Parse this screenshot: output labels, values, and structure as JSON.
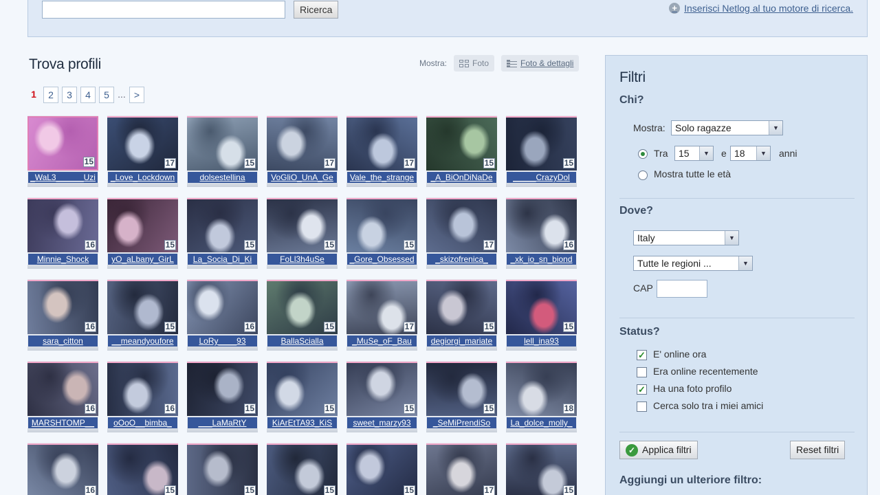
{
  "topbar": {
    "search_value": "",
    "search_button": "Ricerca",
    "add_engine_link": "Inserisci Netlog al tuo motore di ricerca."
  },
  "results": {
    "title": "Trova profili",
    "view_label": "Mostra:",
    "view_photo": "Foto",
    "view_details": "Foto & dettagli"
  },
  "pagination": {
    "current": "1",
    "pages": [
      "2",
      "3",
      "4",
      "5"
    ],
    "dots": "...",
    "next": ">"
  },
  "profiles": [
    {
      "name": "_WaL3______Uzi",
      "age": "15",
      "colors": [
        "#d88ad0",
        "#f1c9e6",
        "#b45fb0"
      ]
    },
    {
      "name": "_Love_Lockdown",
      "age": "17",
      "colors": [
        "#3b4e74",
        "#c9d3e6",
        "#20283c"
      ]
    },
    {
      "name": "dolsestellina",
      "age": "15",
      "colors": [
        "#8fa1b6",
        "#d6dfe8",
        "#4a5a6e"
      ]
    },
    {
      "name": "VoGliO_UnA_Ge",
      "age": "17",
      "colors": [
        "#7284a3",
        "#cbd3e0",
        "#3d4a63"
      ]
    },
    {
      "name": "Vale_the_strange",
      "age": "17",
      "colors": [
        "#5a6f97",
        "#bdc8dd",
        "#2a3550"
      ]
    },
    {
      "name": "_A_BiOnDiNaDe",
      "age": "15",
      "colors": [
        "#4b6a58",
        "#a7c6a2",
        "#25382c"
      ]
    },
    {
      "name": "_____CrazyDol",
      "age": "15",
      "colors": [
        "#36425e",
        "#9aa6bd",
        "#1c2438"
      ]
    },
    {
      "name": "Minnie_Shock",
      "age": "16",
      "colors": [
        "#6a6a95",
        "#c5bfdc",
        "#3c3a5a"
      ]
    },
    {
      "name": "yO_aLbany_GirL",
      "age": "15",
      "colors": [
        "#7d5a78",
        "#d6b2c9",
        "#3b2638"
      ]
    },
    {
      "name": "La_Socia_Di_Ki",
      "age": "15",
      "colors": [
        "#4c5979",
        "#c1c9dc",
        "#2a2f45"
      ]
    },
    {
      "name": "FoLl3h4uSe",
      "age": "15",
      "colors": [
        "#6a7895",
        "#dfe4ee",
        "#2c3348"
      ]
    },
    {
      "name": "_Gore_Obsessed",
      "age": "15",
      "colors": [
        "#6a7fa0",
        "#c8d2e2",
        "#394560"
      ]
    },
    {
      "name": "_skizofrenica_",
      "age": "17",
      "colors": [
        "#5d6c8e",
        "#b9c4d9",
        "#2f374e"
      ]
    },
    {
      "name": "_xk_io_sn_biond",
      "age": "16",
      "colors": [
        "#7c8aa6",
        "#dce2ec",
        "#2d3447"
      ]
    },
    {
      "name": "sara_citton",
      "age": "16",
      "colors": [
        "#6f7d9c",
        "#d4c4c0",
        "#333c52"
      ]
    },
    {
      "name": "__meandyoufore",
      "age": "15",
      "colors": [
        "#54617f",
        "#b0b9cf",
        "#232a3d"
      ]
    },
    {
      "name": "LoRy____93",
      "age": "16",
      "colors": [
        "#8494b3",
        "#dbe2ee",
        "#3c465e"
      ]
    },
    {
      "name": "BallaScialla",
      "age": "15",
      "colors": [
        "#5f7b6e",
        "#c2d4c8",
        "#2d3b45"
      ]
    },
    {
      "name": "_MuSe_oF_Bau",
      "age": "17",
      "colors": [
        "#8a97b0",
        "#dde2ea",
        "#3e4558"
      ]
    },
    {
      "name": "degiorgi_mariate",
      "age": "15",
      "colors": [
        "#5e6a8b",
        "#c9c7d3",
        "#2c3247"
      ]
    },
    {
      "name": "lell_ina93",
      "age": "15",
      "colors": [
        "#5563a0",
        "#d35b7c",
        "#22284a"
      ]
    },
    {
      "name": "MARSHTOMP__",
      "age": "16",
      "colors": [
        "#6c6f8c",
        "#cab5b5",
        "#2e3044"
      ]
    },
    {
      "name": "oOoO__bimba_",
      "age": "16",
      "colors": [
        "#5a6a8f",
        "#c3cbdd",
        "#262e44"
      ]
    },
    {
      "name": "___LaMaRtY",
      "age": "15",
      "colors": [
        "#3f4a67",
        "#aab3c7",
        "#1d2232"
      ]
    },
    {
      "name": "KiArEtTA93_KiS",
      "age": "15",
      "colors": [
        "#6e7fa0",
        "#d2d9e6",
        "#33405e"
      ]
    },
    {
      "name": "sweet_marzy93",
      "age": "15",
      "colors": [
        "#7a86a3",
        "#cfd5e2",
        "#363e55"
      ]
    },
    {
      "name": "_SeMiPrendiSo",
      "age": "15",
      "colors": [
        "#4f5d7f",
        "#b4bdd0",
        "#232a3e"
      ]
    },
    {
      "name": "La_dolce_molly_",
      "age": "18",
      "colors": [
        "#7e8aa4",
        "#d8dce5",
        "#373f54"
      ]
    },
    {
      "name": "",
      "age": "16",
      "colors": [
        "#7a89a6",
        "#ccd2de",
        "#384159"
      ]
    },
    {
      "name": "",
      "age": "15",
      "colors": [
        "#4f5e84",
        "#c8b8c8",
        "#242b42"
      ]
    },
    {
      "name": "",
      "age": "15",
      "colors": [
        "#5c6886",
        "#b6bccc",
        "#2a3043"
      ]
    },
    {
      "name": "",
      "age": "15",
      "colors": [
        "#4b5a7e",
        "#c3cad9",
        "#212839"
      ]
    },
    {
      "name": "",
      "age": "15",
      "colors": [
        "#4f5f8a",
        "#c2c9dc",
        "#232b44"
      ]
    },
    {
      "name": "",
      "age": "17",
      "colors": [
        "#6e7790",
        "#d7d6dc",
        "#33394c"
      ]
    },
    {
      "name": "",
      "age": "15",
      "colors": [
        "#5c6a8a",
        "#c4cad8",
        "#2a3045"
      ]
    }
  ],
  "filters": {
    "title": "Filtri",
    "who_title": "Chi?",
    "show_label": "Mostra:",
    "show_value": "Solo ragazze",
    "between_label": "Tra",
    "age_from": "15",
    "and_label": "e",
    "age_to": "18",
    "years_label": "anni",
    "all_ages_label": "Mostra tutte le età",
    "where_title": "Dove?",
    "country": "Italy",
    "region": "Tutte le regioni ...",
    "cap_label": "CAP",
    "cap_value": "",
    "status_title": "Status?",
    "status_options": [
      {
        "label": "E' online ora",
        "checked": true
      },
      {
        "label": "Era online recentemente",
        "checked": false
      },
      {
        "label": "Ha una foto profilo",
        "checked": true
      },
      {
        "label": "Cerca solo tra i miei amici",
        "checked": false
      }
    ],
    "apply_button": "Applica filtri",
    "reset_button": "Reset filtri",
    "more_filter_title": "Aggiungi un ulteriore filtro:"
  }
}
